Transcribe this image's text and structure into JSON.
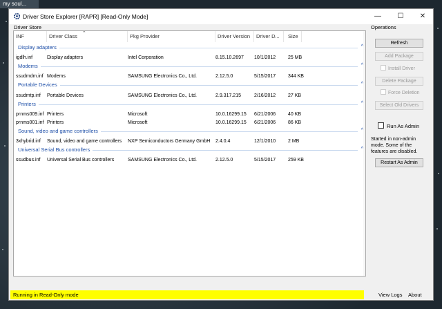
{
  "taskbar": {
    "label": "my soul..."
  },
  "window": {
    "title": "Driver Store Explorer [RAPR] [Read-Only Mode]",
    "minimize": "—",
    "maximize": "☐",
    "close": "✕"
  },
  "driver_store": {
    "label": "Driver Store",
    "columns": [
      "INF",
      "Driver Class",
      "Pkg Provider",
      "Driver Version",
      "Driver D...",
      "Size"
    ],
    "sort_indicator": "^",
    "groups": [
      {
        "name": "Display adapters",
        "collapse": "^",
        "rows": [
          [
            "igdlh.inf",
            "Display adapters",
            "Intel Corporation",
            "8.15.10.2697",
            "10/1/2012",
            "25 MB"
          ]
        ]
      },
      {
        "name": "Modems",
        "collapse": "^",
        "rows": [
          [
            "ssudmdm.inf",
            "Modems",
            "SAMSUNG Electronics Co., Ltd.",
            "2.12.5.0",
            "5/15/2017",
            "344 KB"
          ]
        ]
      },
      {
        "name": "Portable Devices",
        "collapse": "^",
        "rows": [
          [
            "ssudmtp.inf",
            "Portable Devices",
            "SAMSUNG Electronics Co., Ltd.",
            "2.9.317.215",
            "2/16/2012",
            "27 KB"
          ]
        ]
      },
      {
        "name": "Printers",
        "collapse": "^",
        "rows": [
          [
            "prnms009.inf",
            "Printers",
            "Microsoft",
            "10.0.16299.15",
            "6/21/2006",
            "40 KB"
          ],
          [
            "prnms001.inf",
            "Printers",
            "Microsoft",
            "10.0.16299.15",
            "6/21/2006",
            "86 KB"
          ]
        ]
      },
      {
        "name": "Sound, video and game controllers",
        "collapse": "^",
        "rows": [
          [
            "3xhybrid.inf",
            "Sound, video and game controllers",
            "NXP Semiconductors Germany GmbH",
            "2.4.0.4",
            "12/1/2010",
            "2 MB"
          ]
        ]
      },
      {
        "name": "Universal Serial Bus controllers",
        "collapse": "^",
        "rows": [
          [
            "ssudbus.inf",
            "Universal Serial Bus controllers",
            "SAMSUNG Electronics Co., Ltd.",
            "2.12.5.0",
            "5/15/2017",
            "259 KB"
          ]
        ]
      }
    ]
  },
  "operations": {
    "label": "Operations",
    "refresh": "Refresh",
    "add_package": "Add Package",
    "install_driver": "Install Driver",
    "delete_package": "Delete Package",
    "force_deletion": "Force Deletion",
    "select_old_drivers": "Select Old Drivers",
    "run_as_admin": "Run As Admin",
    "note": "Started in non-admin mode. Some of the features are disabled.",
    "restart_as_admin": "Restart As Admin"
  },
  "status": {
    "text": "Running in Read-Only mode",
    "view_logs": "View Logs",
    "about": "About"
  },
  "colors": {
    "status_bg": "#ffff00",
    "group_text": "#1e4fa8"
  },
  "icons": {
    "app": "gear-icon"
  }
}
